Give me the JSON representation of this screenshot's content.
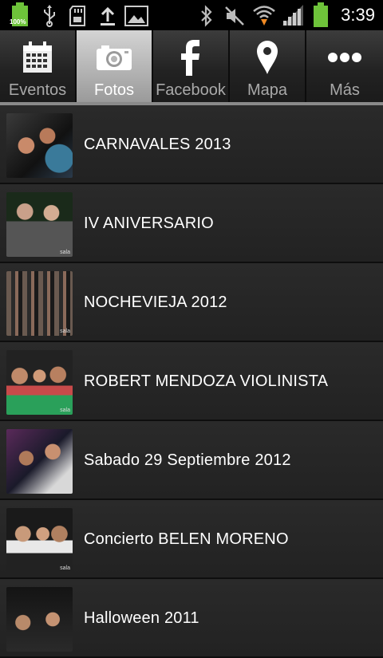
{
  "status_bar": {
    "time": "3:39",
    "battery_label": "100%",
    "left_icons": [
      "battery-icon",
      "usb-icon",
      "sd-card-icon",
      "upload-icon",
      "image-icon"
    ],
    "right_icons": [
      "bluetooth-icon",
      "mute-icon",
      "wifi-icon",
      "signal-icon",
      "battery-icon"
    ]
  },
  "tabs": [
    {
      "label": "Eventos",
      "icon": "calendar-icon",
      "active": false
    },
    {
      "label": "Fotos",
      "icon": "camera-icon",
      "active": true
    },
    {
      "label": "Facebook",
      "icon": "facebook-icon",
      "active": false
    },
    {
      "label": "Mapa",
      "icon": "map-pin-icon",
      "active": false
    },
    {
      "label": "Más",
      "icon": "more-dots-icon",
      "active": false
    }
  ],
  "albums": [
    {
      "title": "CARNAVALES 2013",
      "thumb_watermark": ""
    },
    {
      "title": "IV ANIVERSARIO",
      "thumb_watermark": "sala"
    },
    {
      "title": "NOCHEVIEJA 2012",
      "thumb_watermark": "sala"
    },
    {
      "title": "ROBERT MENDOZA VIOLINISTA",
      "thumb_watermark": "sala"
    },
    {
      "title": "Sabado 29 Septiembre 2012",
      "thumb_watermark": ""
    },
    {
      "title": "Concierto BELEN MORENO",
      "thumb_watermark": "sala"
    },
    {
      "title": "Halloween 2011",
      "thumb_watermark": ""
    }
  ]
}
